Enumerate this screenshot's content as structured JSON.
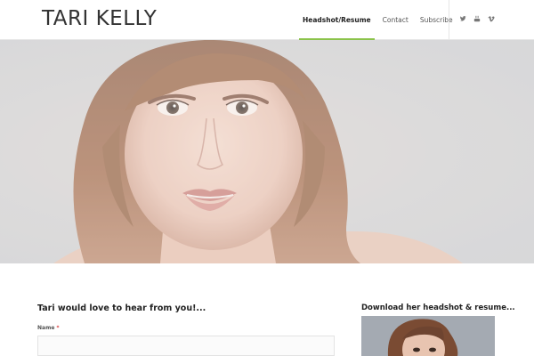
{
  "header": {
    "logo": "TARI KELLY",
    "nav": [
      {
        "label": "Headshot/Resume",
        "active": true
      },
      {
        "label": "Contact",
        "active": false
      },
      {
        "label": "Subscribe",
        "active": false
      }
    ],
    "social": [
      "twitter-icon",
      "youtube-icon",
      "vimeo-icon"
    ],
    "accent_color": "#8bc34a"
  },
  "hero": {
    "image": "portrait-photo"
  },
  "contact": {
    "title": "Tari would love to hear from you!...",
    "name_label": "Name",
    "required_mark": "*",
    "name_value": ""
  },
  "sidebar": {
    "title": "Download her headshot & resume...",
    "image": "headshot-thumbnail"
  }
}
